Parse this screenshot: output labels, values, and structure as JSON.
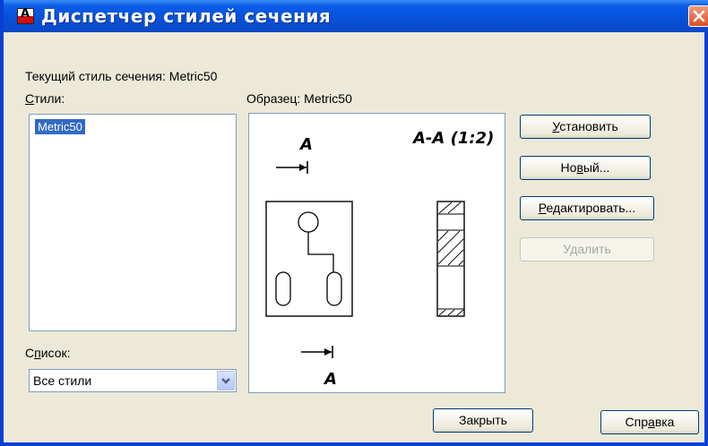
{
  "window": {
    "title": "Диспетчер стилей сечения",
    "icon_letter": "A"
  },
  "current_style": {
    "label": "Текущий стиль сечения: Metric50"
  },
  "styles": {
    "label": "Стили:",
    "accesskey": "С",
    "label_rest": "тили:",
    "items": [
      "Metric50"
    ],
    "selected": "Metric50"
  },
  "preview": {
    "label": "Образец: Metric50",
    "section_title": "А-А (1:2)",
    "cut_letter_top": "А",
    "cut_letter_bottom": "А"
  },
  "list_filter": {
    "label_pre": "С",
    "label_key": "п",
    "label_rest": "исок:",
    "value": "Все стили"
  },
  "buttons": {
    "set": {
      "key": "У",
      "rest": "становить"
    },
    "new": {
      "pre": "Но",
      "key": "в",
      "rest": "ый..."
    },
    "edit": {
      "key": "Р",
      "rest": "едактировать..."
    },
    "delete": {
      "pre": "У",
      "key": "д",
      "rest": "алить",
      "disabled": true
    },
    "close": {
      "label": "Закрыть"
    },
    "help": {
      "pre": "Спр",
      "key": "а",
      "rest": "вка"
    }
  },
  "colors": {
    "titlebar": "#0a5ce8",
    "selection": "#316ac5",
    "dialog_bg": "#ece9d8"
  }
}
